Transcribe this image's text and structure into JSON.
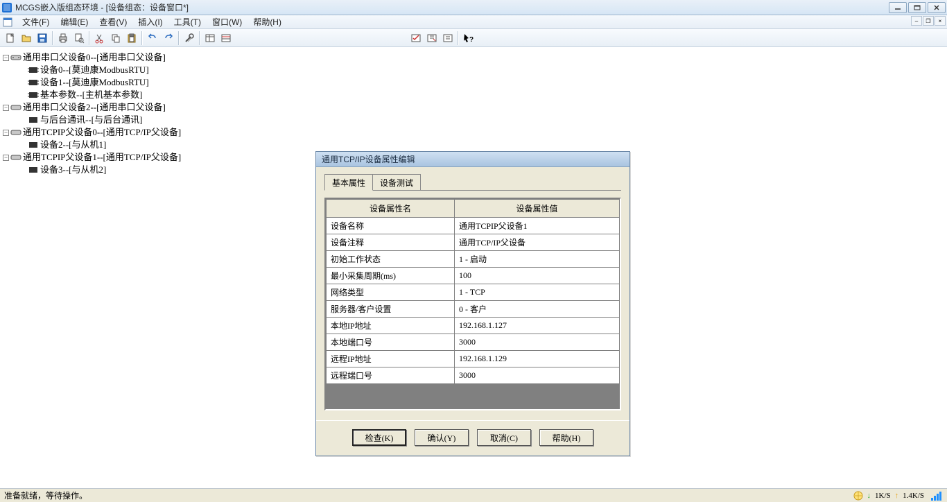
{
  "window": {
    "title": "MCGS嵌入版组态环境 - [设备组态：设备窗口*]"
  },
  "menu": {
    "items": [
      "文件(F)",
      "编辑(E)",
      "查看(V)",
      "插入(I)",
      "工具(T)",
      "窗口(W)",
      "帮助(H)"
    ]
  },
  "tree": {
    "n0": "通用串口父设备0--[通用串口父设备]",
    "n0c0": "设备0--[莫迪康ModbusRTU]",
    "n0c1": "设备1--[莫迪康ModbusRTU]",
    "n0c2": "基本参数--[主机基本参数]",
    "n1": "通用串口父设备2--[通用串口父设备]",
    "n1c0": "与后台通讯--[与后台通讯]",
    "n2": "通用TCPIP父设备0--[通用TCP/IP父设备]",
    "n2c0": "设备2--[与从机1]",
    "n3": "通用TCPIP父设备1--[通用TCP/IP父设备]",
    "n3c0": "设备3--[与从机2]"
  },
  "dialog": {
    "title": "通用TCP/IP设备属性编辑",
    "tabs": {
      "t1": "基本属性",
      "t2": "设备测试"
    },
    "headers": {
      "name": "设备属性名",
      "value": "设备属性值"
    },
    "rows": [
      {
        "name": "设备名称",
        "value": "通用TCPIP父设备1"
      },
      {
        "name": "设备注释",
        "value": "通用TCP/IP父设备"
      },
      {
        "name": "初始工作状态",
        "value": "1 - 启动"
      },
      {
        "name": "最小采集周期(ms)",
        "value": "100"
      },
      {
        "name": "网络类型",
        "value": "1 - TCP"
      },
      {
        "name": "服务器/客户设置",
        "value": "0 - 客户"
      },
      {
        "name": "本地IP地址",
        "value": "192.168.1.127"
      },
      {
        "name": "本地端口号",
        "value": "3000"
      },
      {
        "name": "远程IP地址",
        "value": "192.168.1.129"
      },
      {
        "name": "远程端口号",
        "value": "3000"
      }
    ],
    "buttons": {
      "check": "检查(K)",
      "ok": "确认(Y)",
      "cancel": "取消(C)",
      "help": "帮助(H)"
    }
  },
  "status": {
    "text": "准备就绪，等待操作。",
    "down": "1K/S",
    "up": "1.4K/S"
  }
}
